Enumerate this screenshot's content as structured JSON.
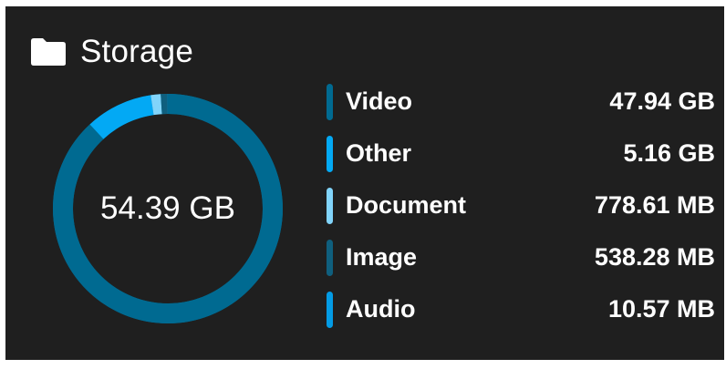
{
  "storage": {
    "title": "Storage",
    "icon": "folder-icon",
    "total": "54.39 GB",
    "items": [
      {
        "label": "Video",
        "value": "47.94 GB",
        "color": "#006a91"
      },
      {
        "label": "Other",
        "value": "5.16 GB",
        "color": "#03a9f4"
      },
      {
        "label": "Document",
        "value": "778.61 MB",
        "color": "#81d4fa"
      },
      {
        "label": "Image",
        "value": "538.28 MB",
        "color": "#0f5f7e"
      },
      {
        "label": "Audio",
        "value": "10.57 MB",
        "color": "#039be5"
      }
    ]
  },
  "chart_data": {
    "type": "pie",
    "categories": [
      "Video",
      "Other",
      "Document",
      "Image",
      "Audio"
    ],
    "values_mb": [
      49090.56,
      5283.84,
      778.61,
      538.28,
      10.57
    ],
    "colors": [
      "#006a91",
      "#03a9f4",
      "#81d4fa",
      "#0f5f7e",
      "#039be5"
    ]
  }
}
